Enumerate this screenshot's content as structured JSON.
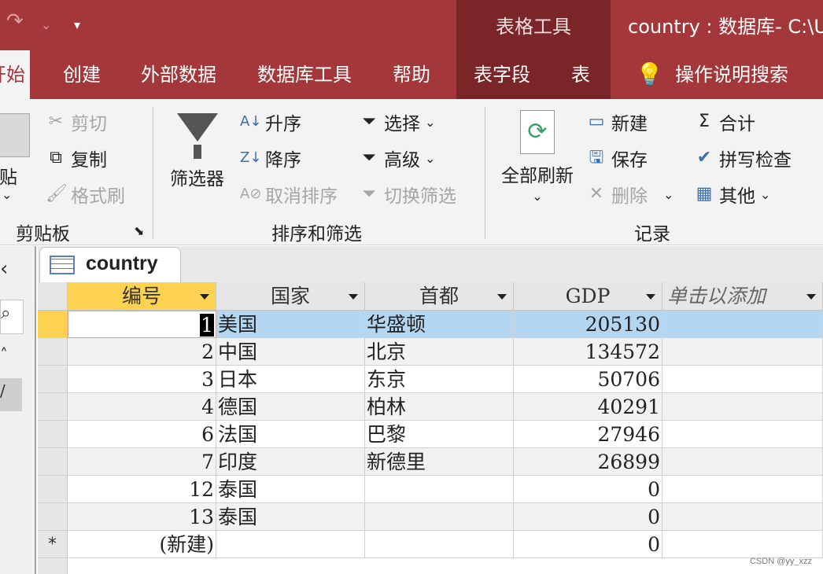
{
  "titlebar": {
    "context_label": "表格工具",
    "window_title": "country : 数据库- C:\\U"
  },
  "tabs": [
    "开始",
    "创建",
    "外部数据",
    "数据库工具",
    "帮助",
    "表字段",
    "表"
  ],
  "tell_me": "操作说明搜索",
  "ribbon": {
    "clipboard": {
      "paste": "粘贴",
      "cut": "剪切",
      "copy": "复制",
      "format_painter": "格式刷",
      "group": "剪贴板"
    },
    "sort_filter": {
      "filter": "筛选器",
      "ascending": "升序",
      "descending": "降序",
      "clear_sort": "取消排序",
      "selection": "选择",
      "advanced": "高级",
      "toggle_filter": "切换筛选",
      "group": "排序和筛选"
    },
    "records": {
      "refresh_all": "全部刷新",
      "new": "新建",
      "save": "保存",
      "delete": "删除",
      "totals": "合计",
      "spelling": "拼写检查",
      "more": "其他",
      "group": "记录"
    }
  },
  "document_tab": "country",
  "columns": [
    "编号",
    "国家",
    "首都",
    "GDP",
    "单击以添加"
  ],
  "rows": [
    {
      "id": "1",
      "country": "美国",
      "capital": "华盛顿",
      "gdp": "205130"
    },
    {
      "id": "2",
      "country": "中国",
      "capital": "北京",
      "gdp": "134572"
    },
    {
      "id": "3",
      "country": "日本",
      "capital": "东京",
      "gdp": "50706"
    },
    {
      "id": "4",
      "country": "德国",
      "capital": "柏林",
      "gdp": "40291"
    },
    {
      "id": "6",
      "country": "法国",
      "capital": "巴黎",
      "gdp": "27946"
    },
    {
      "id": "7",
      "country": "印度",
      "capital": "新德里",
      "gdp": "26899"
    },
    {
      "id": "12",
      "country": "泰国",
      "capital": "",
      "gdp": "0"
    },
    {
      "id": "13",
      "country": "泰国",
      "capital": "",
      "gdp": "0"
    }
  ],
  "new_row": {
    "marker": "*",
    "id": "(新建)",
    "gdp": "0"
  },
  "watermark": "CSDN @yy_xzz"
}
